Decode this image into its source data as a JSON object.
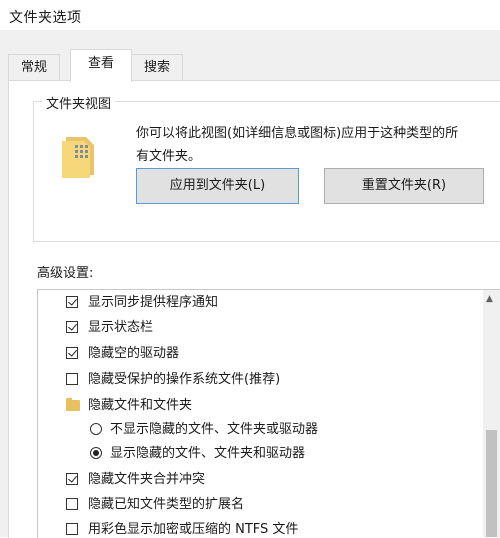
{
  "window": {
    "title": "文件夹选项"
  },
  "tabs": [
    {
      "label": "常规"
    },
    {
      "label": "查看"
    },
    {
      "label": "搜索"
    }
  ],
  "folder_view": {
    "title": "文件夹视图",
    "description_line1": "你可以将此视图(如详细信息或图标)应用于这种类型的所",
    "description_line2": "有文件夹。",
    "apply_button": "应用到文件夹(L)",
    "reset_button": "重置文件夹(R)"
  },
  "advanced": {
    "label": "高级设置:",
    "items": [
      {
        "type": "checkbox",
        "checked": true,
        "label": "显示同步提供程序通知"
      },
      {
        "type": "checkbox",
        "checked": true,
        "label": "显示状态栏"
      },
      {
        "type": "checkbox",
        "checked": true,
        "label": "隐藏空的驱动器"
      },
      {
        "type": "checkbox",
        "checked": false,
        "label": "隐藏受保护的操作系统文件(推荐)"
      },
      {
        "type": "folder",
        "label": "隐藏文件和文件夹"
      },
      {
        "type": "radio",
        "selected": false,
        "label": "不显示隐藏的文件、文件夹或驱动器"
      },
      {
        "type": "radio",
        "selected": true,
        "label": "显示隐藏的文件、文件夹和驱动器"
      },
      {
        "type": "checkbox",
        "checked": true,
        "label": "隐藏文件夹合并冲突"
      },
      {
        "type": "checkbox",
        "checked": false,
        "label": "隐藏已知文件类型的扩展名"
      },
      {
        "type": "checkbox",
        "checked": false,
        "label": "用彩色显示加密或压缩的 NTFS 文件"
      }
    ]
  },
  "colors": {
    "accent": "#5b9ad6",
    "folder": "#e8c05f"
  }
}
